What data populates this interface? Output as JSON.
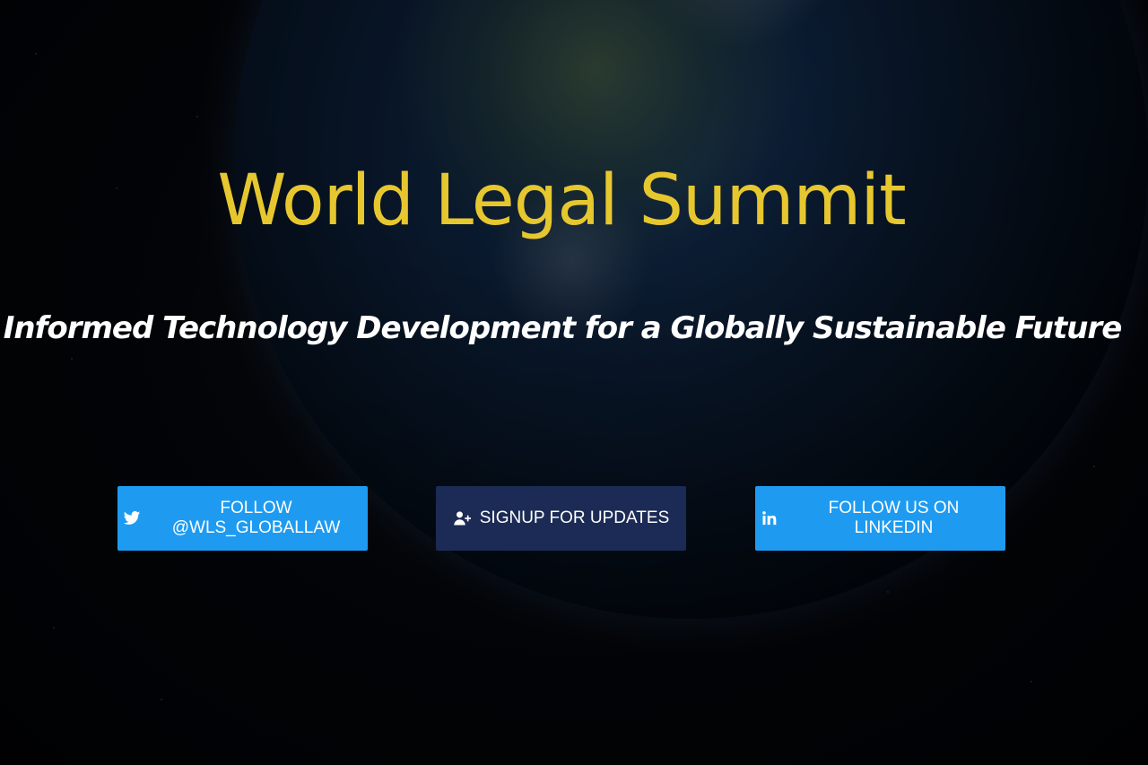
{
  "hero": {
    "title": "World Legal Summit",
    "subtitle": "Informed Technology Development for a Globally Sustainable Future"
  },
  "buttons": [
    {
      "label": "FOLLOW @WLS_GLOBALLAW",
      "icon": "twitter-icon",
      "color": "#1e9bf0"
    },
    {
      "label": "SIGNUP FOR UPDATES",
      "icon": "user-plus-icon",
      "color": "#1c2b55"
    },
    {
      "label": "FOLLOW US ON LINKEDIN",
      "icon": "linkedin-icon",
      "color": "#1e9bf0"
    }
  ],
  "colors": {
    "title": "#e6c72f",
    "subtitle": "#ffffff",
    "background": "#05070b"
  }
}
